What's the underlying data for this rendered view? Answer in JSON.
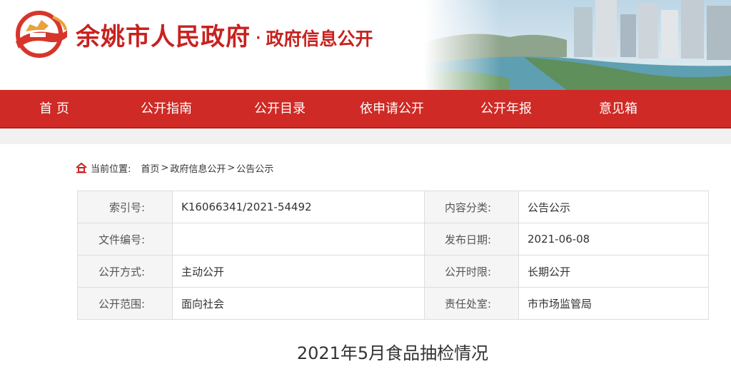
{
  "header": {
    "site_name": "余姚市人民政府",
    "separator": "·",
    "section_name": "政府信息公开"
  },
  "colors": {
    "brand_red": "#cf2a25",
    "title_red": "#c8221f",
    "label_bg": "#f5f5f5",
    "border": "#dddddd"
  },
  "nav": {
    "items": [
      "首 页",
      "公开指南",
      "公开目录",
      "依申请公开",
      "公开年报",
      "意见箱"
    ]
  },
  "breadcrumb": {
    "prefix": "当前位置:",
    "items": [
      "首页",
      "政府信息公开",
      "公告公示"
    ],
    "separator": ">"
  },
  "info": {
    "rows": [
      {
        "label1": "索引号:",
        "value1": "K16066341/2021-54492",
        "label2": "内容分类:",
        "value2": "公告公示"
      },
      {
        "label1": "文件编号:",
        "value1": "",
        "label2": "发布日期:",
        "value2": "2021-06-08"
      },
      {
        "label1": "公开方式:",
        "value1": "主动公开",
        "label2": "公开时限:",
        "value2": "长期公开"
      },
      {
        "label1": "公开范围:",
        "value1": "面向社会",
        "label2": "责任处室:",
        "value2": "市市场监管局"
      }
    ]
  },
  "document": {
    "title": "2021年5月食品抽检情况"
  }
}
